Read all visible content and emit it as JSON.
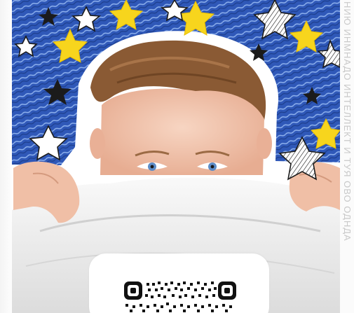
{
  "image": {
    "subject": "photo-collage",
    "side_caption": "НИЮ ИНМНАДО ИНТЕЛЛЕКТ И ТУЯ ОВО ОДНДА"
  },
  "qr_card": {
    "icon": "qr-code-icon"
  },
  "colors": {
    "sky_blue": "#2f4f9e",
    "star_yellow": "#f7d51d",
    "blanket": "#efefef",
    "skin": "#f1c7b1",
    "hair": "#8a5a34"
  }
}
